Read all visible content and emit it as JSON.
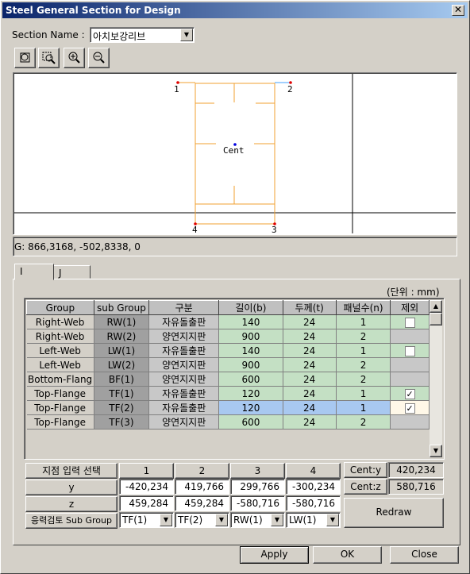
{
  "window": {
    "title": "Steel General Section for Design",
    "close": "✕"
  },
  "section": {
    "label": "Section Name :",
    "value": "아치보강리브"
  },
  "toolbar": [
    "zoom-fit-icon",
    "zoom-window-icon",
    "zoom-in-icon",
    "zoom-out-icon"
  ],
  "canvas": {
    "points": {
      "p1": "1",
      "p2": "2",
      "p3": "3",
      "p4": "4",
      "cent": "Cent"
    }
  },
  "coord_text": "G: 866,3168, -502,8338, 0",
  "tabs": [
    "I",
    "J"
  ],
  "unit_label": "(단위 : mm)",
  "table": {
    "headers": [
      "Group",
      "sub Group",
      "구분",
      "길이(b)",
      "두께(t)",
      "패널수(n)",
      "제외"
    ],
    "rows": [
      {
        "group": "Right-Web",
        "sub": "RW(1)",
        "type": "자유돌출판",
        "b": "140",
        "t": "24",
        "n": "1",
        "ex": "unchecked"
      },
      {
        "group": "Right-Web",
        "sub": "RW(2)",
        "type": "양연지지판",
        "b": "900",
        "t": "24",
        "n": "2",
        "ex": "none"
      },
      {
        "group": "Left-Web",
        "sub": "LW(1)",
        "type": "자유돌출판",
        "b": "140",
        "t": "24",
        "n": "1",
        "ex": "unchecked"
      },
      {
        "group": "Left-Web",
        "sub": "LW(2)",
        "type": "양연지지판",
        "b": "900",
        "t": "24",
        "n": "2",
        "ex": "none"
      },
      {
        "group": "Bottom-Flang",
        "sub": "BF(1)",
        "type": "양연지지판",
        "b": "600",
        "t": "24",
        "n": "2",
        "ex": "none"
      },
      {
        "group": "Top-Flange",
        "sub": "TF(1)",
        "type": "자유돌출판",
        "b": "120",
        "t": "24",
        "n": "1",
        "ex": "checked"
      },
      {
        "group": "Top-Flange",
        "sub": "TF(2)",
        "type": "자유돌출판",
        "b": "120",
        "t": "24",
        "n": "1",
        "ex": "checked",
        "selected": true
      },
      {
        "group": "Top-Flange",
        "sub": "TF(3)",
        "type": "양연지지판",
        "b": "600",
        "t": "24",
        "n": "2",
        "ex": "none"
      }
    ]
  },
  "points_table": {
    "header_label": "지점 입력 선택",
    "cols": [
      "1",
      "2",
      "3",
      "4"
    ],
    "y_label": "y",
    "z_label": "z",
    "y": [
      "-420,234",
      "419,766",
      "299,766",
      "-300,234"
    ],
    "z": [
      "459,284",
      "459,284",
      "-580,716",
      "-580,716"
    ],
    "sub_label": "응력검토 Sub Group",
    "sub": [
      "TF(1)",
      "TF(2)",
      "RW(1)",
      "LW(1)"
    ]
  },
  "cent": {
    "y_label": "Cent:y",
    "y": "420,234",
    "z_label": "Cent:z",
    "z": "580,716"
  },
  "buttons": {
    "redraw": "Redraw",
    "apply": "Apply",
    "ok": "OK",
    "close": "Close"
  }
}
